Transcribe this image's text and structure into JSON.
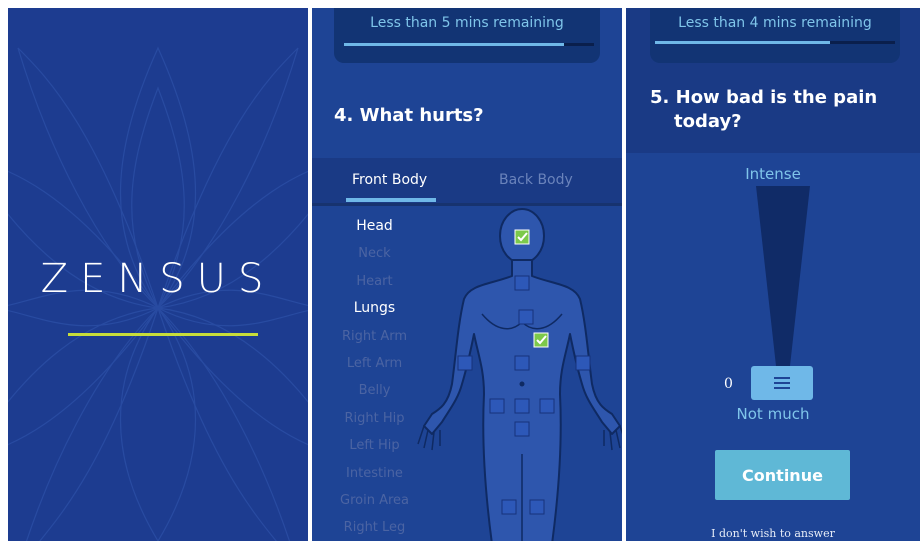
{
  "splash": {
    "app_name": "ZENSUS",
    "colors": {
      "background": "#1d3c90",
      "accent": "#c7dd3a"
    }
  },
  "body_screen": {
    "progress": {
      "text": "Less than 5 mins remaining",
      "fraction": 0.88
    },
    "question": "4.  What hurts?",
    "tabs": [
      {
        "label": "Front Body",
        "active": true
      },
      {
        "label": "Back Body",
        "active": false
      }
    ],
    "body_parts": [
      {
        "label": "Head",
        "selected": true
      },
      {
        "label": "Neck",
        "selected": false
      },
      {
        "label": "Heart",
        "selected": false
      },
      {
        "label": "Lungs",
        "selected": true
      },
      {
        "label": "Right Arm",
        "selected": false
      },
      {
        "label": "Left Arm",
        "selected": false
      },
      {
        "label": "Belly",
        "selected": false
      },
      {
        "label": "Right Hip",
        "selected": false
      },
      {
        "label": "Left Hip",
        "selected": false
      },
      {
        "label": "Intestine",
        "selected": false
      },
      {
        "label": "Groin Area",
        "selected": false
      },
      {
        "label": "Right Leg",
        "selected": false
      }
    ],
    "body_markers_checked": [
      "head",
      "lungs"
    ]
  },
  "pain_screen": {
    "progress": {
      "text": "Less than 4 mins remaining",
      "fraction": 0.73
    },
    "question_line1": "5.  How bad is the pain",
    "question_line2": "today?",
    "scale_top_label": "Intense",
    "scale_bottom_label": "Not much",
    "min_value": "0",
    "slider_level": 0,
    "continue_label": "Continue",
    "skip_label": "I don't wish to answer",
    "colors": {
      "button": "#5fb8d6",
      "accent": "#6fb8e8"
    }
  }
}
